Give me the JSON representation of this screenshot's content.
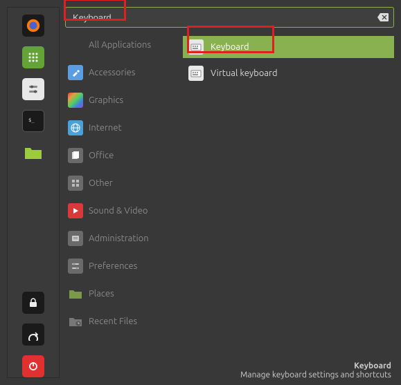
{
  "search": {
    "value": "Keyboard"
  },
  "sidebar": [
    {
      "name": "firefox"
    },
    {
      "name": "apps-grid"
    },
    {
      "name": "system-settings"
    },
    {
      "name": "terminal"
    },
    {
      "name": "files"
    },
    {
      "name": "lock"
    },
    {
      "name": "logout"
    },
    {
      "name": "power"
    }
  ],
  "categories": [
    {
      "label": "All Applications",
      "icon": "none"
    },
    {
      "label": "Accessories",
      "icon": "accessories"
    },
    {
      "label": "Graphics",
      "icon": "graphics"
    },
    {
      "label": "Internet",
      "icon": "internet"
    },
    {
      "label": "Office",
      "icon": "office"
    },
    {
      "label": "Other",
      "icon": "other"
    },
    {
      "label": "Sound & Video",
      "icon": "sound"
    },
    {
      "label": "Administration",
      "icon": "admin"
    },
    {
      "label": "Preferences",
      "icon": "prefs"
    },
    {
      "label": "Places",
      "icon": "places"
    },
    {
      "label": "Recent Files",
      "icon": "recent"
    }
  ],
  "results": [
    {
      "label": "Keyboard",
      "selected": true
    },
    {
      "label": "Virtual keyboard",
      "selected": false
    }
  ],
  "footer": {
    "title": "Keyboard",
    "desc": "Manage keyboard settings and shortcuts"
  }
}
